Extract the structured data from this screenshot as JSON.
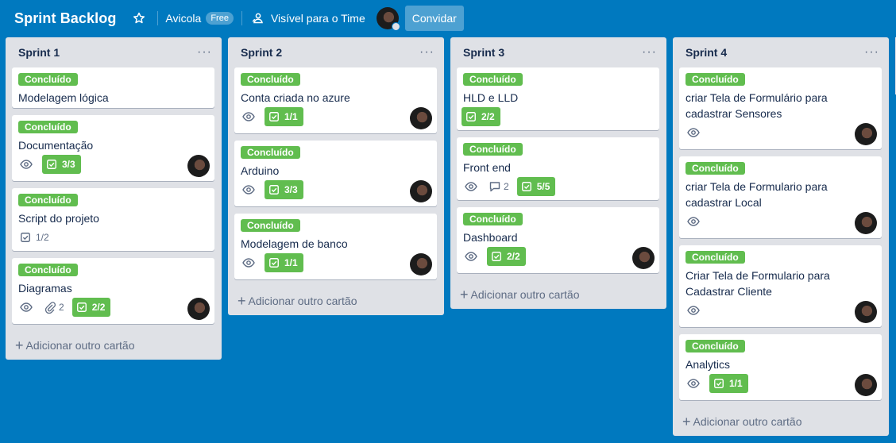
{
  "header": {
    "board_title": "Sprint Backlog",
    "workspace_name": "Avicola",
    "workspace_badge": "Free",
    "visibility": "Visível para o Time",
    "invite_label": "Convidar"
  },
  "colors": {
    "background": "#0079bf",
    "list": "#dfe1e6",
    "label_green": "#61bd4f"
  },
  "lists": [
    {
      "title": "Sprint 1",
      "menu": "···",
      "add_card": "Adicionar outro cartão",
      "cards": [
        {
          "label": "Concluído",
          "title": "Modelagem lógica"
        },
        {
          "label": "Concluído",
          "title": "Documentação",
          "checklist": "3/3"
        },
        {
          "label": "Concluído",
          "title": "Script do projeto",
          "checklist_plain": "1/2"
        },
        {
          "label": "Concluído",
          "title": "Diagramas",
          "attachments": "2",
          "checklist": "2/2"
        }
      ]
    },
    {
      "title": "Sprint 2",
      "menu": "···",
      "add_card": "Adicionar outro cartão",
      "cards": [
        {
          "label": "Concluído",
          "title": "Conta criada no azure",
          "checklist": "1/1"
        },
        {
          "label": "Concluído",
          "title": "Arduino",
          "checklist": "3/3"
        },
        {
          "label": "Concluído",
          "title": "Modelagem de banco",
          "checklist": "1/1"
        }
      ]
    },
    {
      "title": "Sprint 3",
      "menu": "···",
      "add_card": "Adicionar outro cartão",
      "cards": [
        {
          "label": "Concluído",
          "title": "HLD e LLD",
          "checklist": "2/2"
        },
        {
          "label": "Concluído",
          "title": "Front end",
          "comments": "2",
          "checklist": "5/5"
        },
        {
          "label": "Concluído",
          "title": "Dashboard",
          "checklist": "2/2"
        }
      ]
    },
    {
      "title": "Sprint 4",
      "menu": "···",
      "add_card": "Adicionar outro cartão",
      "cards": [
        {
          "label": "Concluído",
          "title": "criar Tela de Formulário para cadastrar Sensores"
        },
        {
          "label": "Concluído",
          "title": "criar Tela de Formulario para cadastrar Local"
        },
        {
          "label": "Concluído",
          "title": "Criar Tela de Formulario para Cadastrar Cliente"
        },
        {
          "label": "Concluído",
          "title": "Analytics",
          "checklist": "1/1"
        }
      ]
    }
  ]
}
